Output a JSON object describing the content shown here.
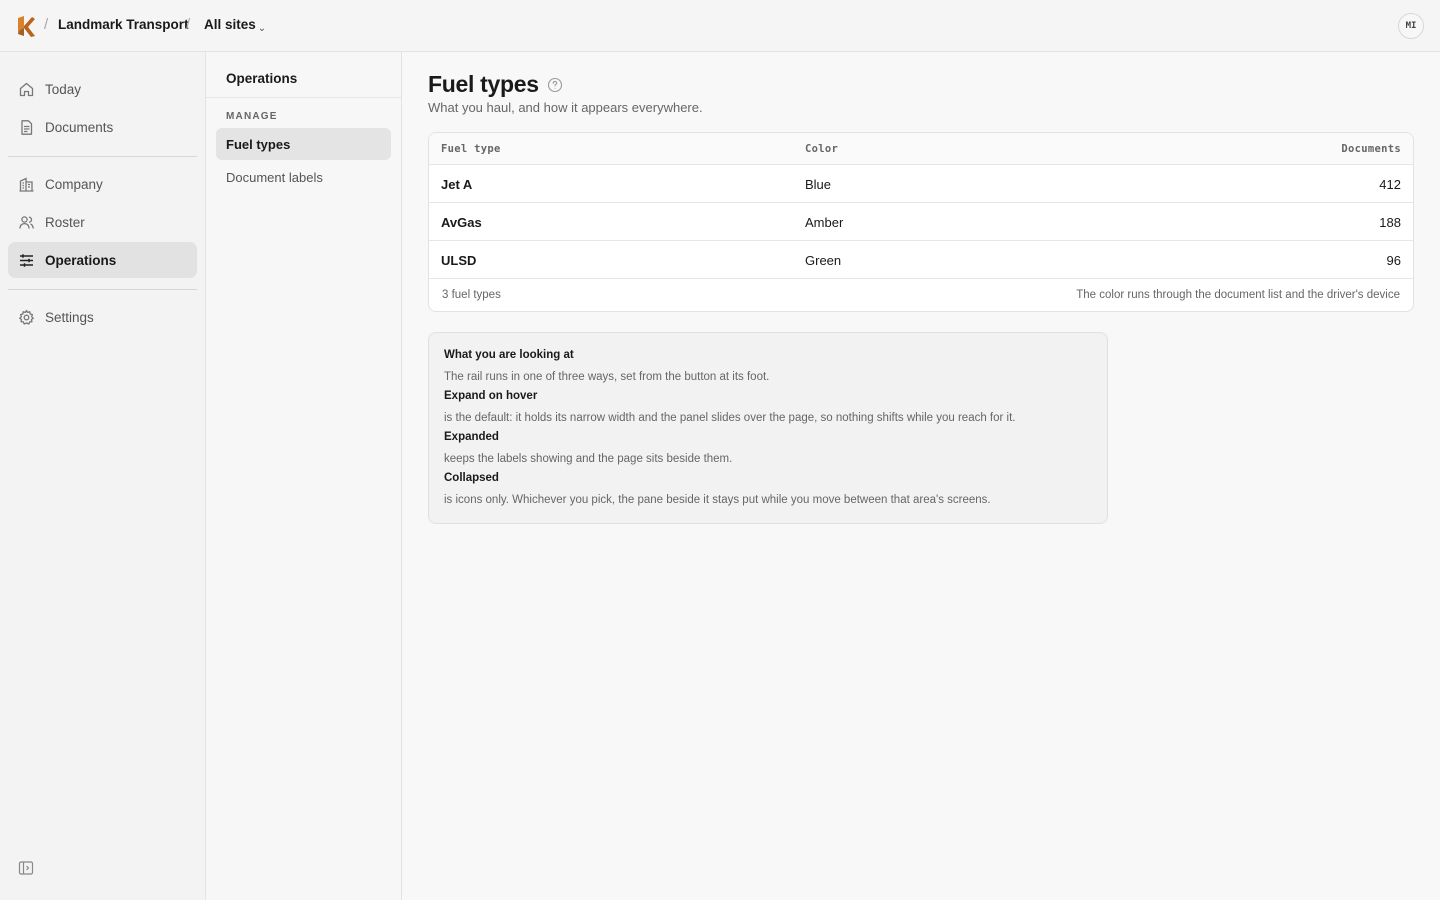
{
  "header": {
    "org": "Landmark Transport",
    "sites": "All sites",
    "avatar_initials": "MI"
  },
  "rail": {
    "items": [
      {
        "label": "Today",
        "icon": "home-icon"
      },
      {
        "label": "Documents",
        "icon": "document-icon"
      },
      {
        "label": "Company",
        "icon": "building-icon"
      },
      {
        "label": "Roster",
        "icon": "people-icon"
      },
      {
        "label": "Operations",
        "icon": "sliders-icon",
        "active": true
      },
      {
        "label": "Settings",
        "icon": "gear-icon"
      }
    ]
  },
  "subnav": {
    "title": "Operations",
    "section": "MANAGE",
    "items": [
      {
        "label": "Fuel types",
        "active": true
      },
      {
        "label": "Document labels"
      }
    ]
  },
  "main": {
    "title": "Fuel types",
    "subtitle": "What you haul, and how it appears everywhere.",
    "table": {
      "columns": [
        "Fuel type",
        "Color",
        "Documents"
      ],
      "rows": [
        {
          "name": "Jet A",
          "color": "Blue",
          "documents": "412"
        },
        {
          "name": "AvGas",
          "color": "Amber",
          "documents": "188"
        },
        {
          "name": "ULSD",
          "color": "Green",
          "documents": "96"
        }
      ],
      "footer_left": "3 fuel types",
      "footer_right": "The color runs through the document list and the driver's device"
    },
    "info": {
      "heading": "What you are looking at",
      "intro": "The rail runs in one of three ways, set from the button at its foot.",
      "modes": [
        {
          "name": "Expand on hover",
          "desc": "is the default: it holds its narrow width and the panel slides over the page, so nothing shifts while you reach for it."
        },
        {
          "name": "Expanded",
          "desc": "keeps the labels showing and the page sits beside them."
        },
        {
          "name": "Collapsed",
          "desc": "is icons only. Whichever you pick, the pane beside it stays put while you move between that area's screens."
        }
      ]
    }
  },
  "colors": {
    "logo_orange": "#d9822b",
    "logo_dark": "#2b2b2b",
    "active_bg": "#e2e2e2"
  }
}
